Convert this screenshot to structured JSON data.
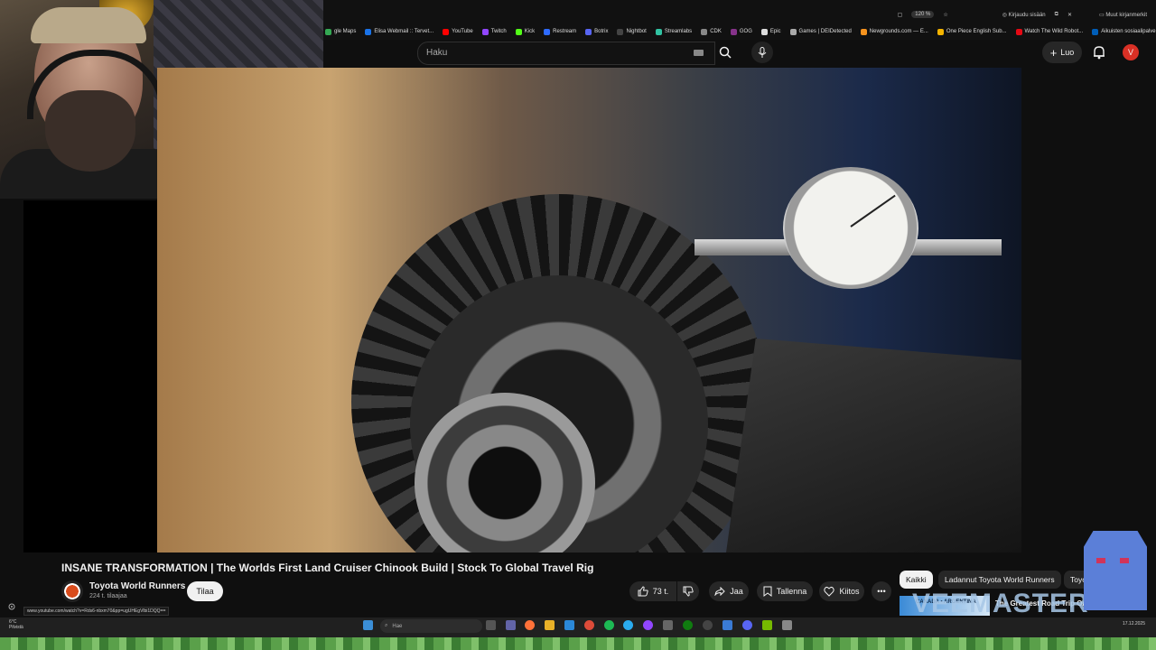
{
  "browser": {
    "bookmarks": [
      {
        "label": "gle Maps",
        "color": "#34a853"
      },
      {
        "label": "Elisa Webmail :: Tervet...",
        "color": "#1a73e8"
      },
      {
        "label": "YouTube",
        "color": "#ff0000"
      },
      {
        "label": "Twitch",
        "color": "#9146ff"
      },
      {
        "label": "Kick",
        "color": "#53fc18"
      },
      {
        "label": "Restream",
        "color": "#2e6bff"
      },
      {
        "label": "Botrix",
        "color": "#5865f2"
      },
      {
        "label": "Nightbot",
        "color": "#444444"
      },
      {
        "label": "Streamlabs",
        "color": "#31c3a2"
      },
      {
        "label": "CDK",
        "color": "#888888"
      },
      {
        "label": "GOG",
        "color": "#86328a"
      },
      {
        "label": "Epic",
        "color": "#dddddd"
      },
      {
        "label": "Games | DEIDetected",
        "color": "#aaaaaa"
      },
      {
        "label": "Newgrounds.com — E...",
        "color": "#f7931e"
      },
      {
        "label": "One Piece English Sub...",
        "color": "#f4b400"
      },
      {
        "label": "Watch The Wild Robot...",
        "color": "#e50914"
      },
      {
        "label": "Aikuisten sosiaalipalve...",
        "color": "#005eb8"
      }
    ],
    "other_bookmarks": "Muut kirjanmerkit",
    "zoom": "120 %",
    "login": "Kirjaudu sisään"
  },
  "youtube": {
    "search_placeholder": "Haku",
    "create_label": "Luo",
    "avatar_letter": "V"
  },
  "video": {
    "title": "INSANE TRANSFORMATION | The Worlds First Land Cruiser Chinook Build | Stock To Global Travel Rig",
    "channel": "Toyota World Runners",
    "subscribers": "224 t. tilaajaa",
    "subscribe_label": "Tilaa",
    "likes": "73 t.",
    "share_label": "Jaa",
    "save_label": "Tallenna",
    "thanks_label": "Kiitos",
    "url_tooltip": "www.youtube.com/watch?v=Rds6-nbxm70&pp=ugUHEgVlbi1DQQ=="
  },
  "chips": {
    "all": "Kaikki",
    "runners": "Ladannut Toyota World Runners",
    "toyota": "Toyo"
  },
  "recommended": {
    "title": "The Greatest Road Trip On",
    "thumb_text": "CANADA • ARGENTINA"
  },
  "overlay": {
    "watermark": "VEEMASTER"
  },
  "taskbar": {
    "weather_temp": "6°C",
    "weather_desc": "Pilvistä",
    "search_placeholder": "Hae",
    "date": "17.12.2025"
  }
}
